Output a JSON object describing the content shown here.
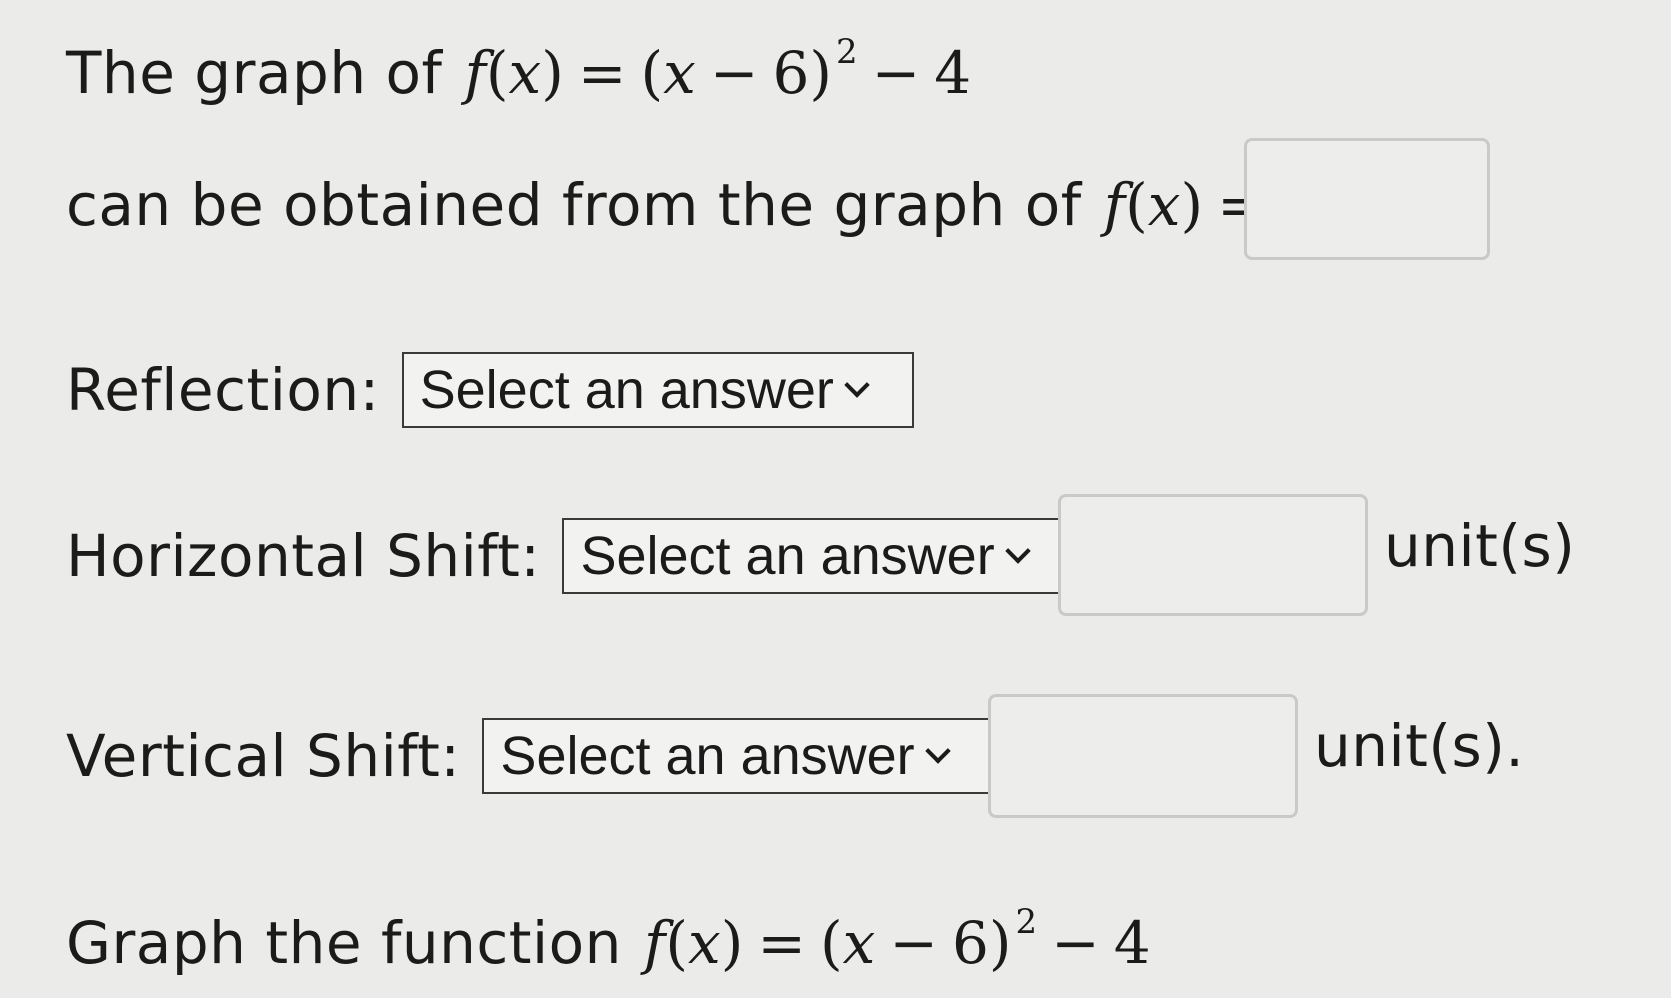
{
  "line1": {
    "prefix": "The graph of",
    "fn": "f",
    "var": "x",
    "eq": "=",
    "expr_open": "(",
    "expr_var": "x",
    "expr_minus": "−",
    "expr_const": "6)",
    "exponent": "2",
    "tail_minus": "−",
    "tail_const": "4"
  },
  "line2": {
    "prefix": "can be obtained from the graph of",
    "fn": "f",
    "var": "x",
    "eq": "=",
    "answer_value": ""
  },
  "reflection": {
    "label": "Reflection:",
    "select_value": "Select an answer"
  },
  "horizontal_shift": {
    "label": "Horizontal Shift:",
    "select_value": "Select an answer",
    "amount_value": "",
    "unit": "unit(s)"
  },
  "vertical_shift": {
    "label": "Vertical Shift:",
    "select_value": "Select an answer",
    "amount_value": "",
    "unit": "unit(s)."
  },
  "graph_prompt": {
    "prefix": "Graph the function",
    "fn": "f",
    "var": "x",
    "eq": "=",
    "expr_open": "(",
    "expr_var": "x",
    "expr_minus": "−",
    "expr_const": "6)",
    "exponent": "2",
    "tail_minus": "−",
    "tail_const": "4"
  }
}
